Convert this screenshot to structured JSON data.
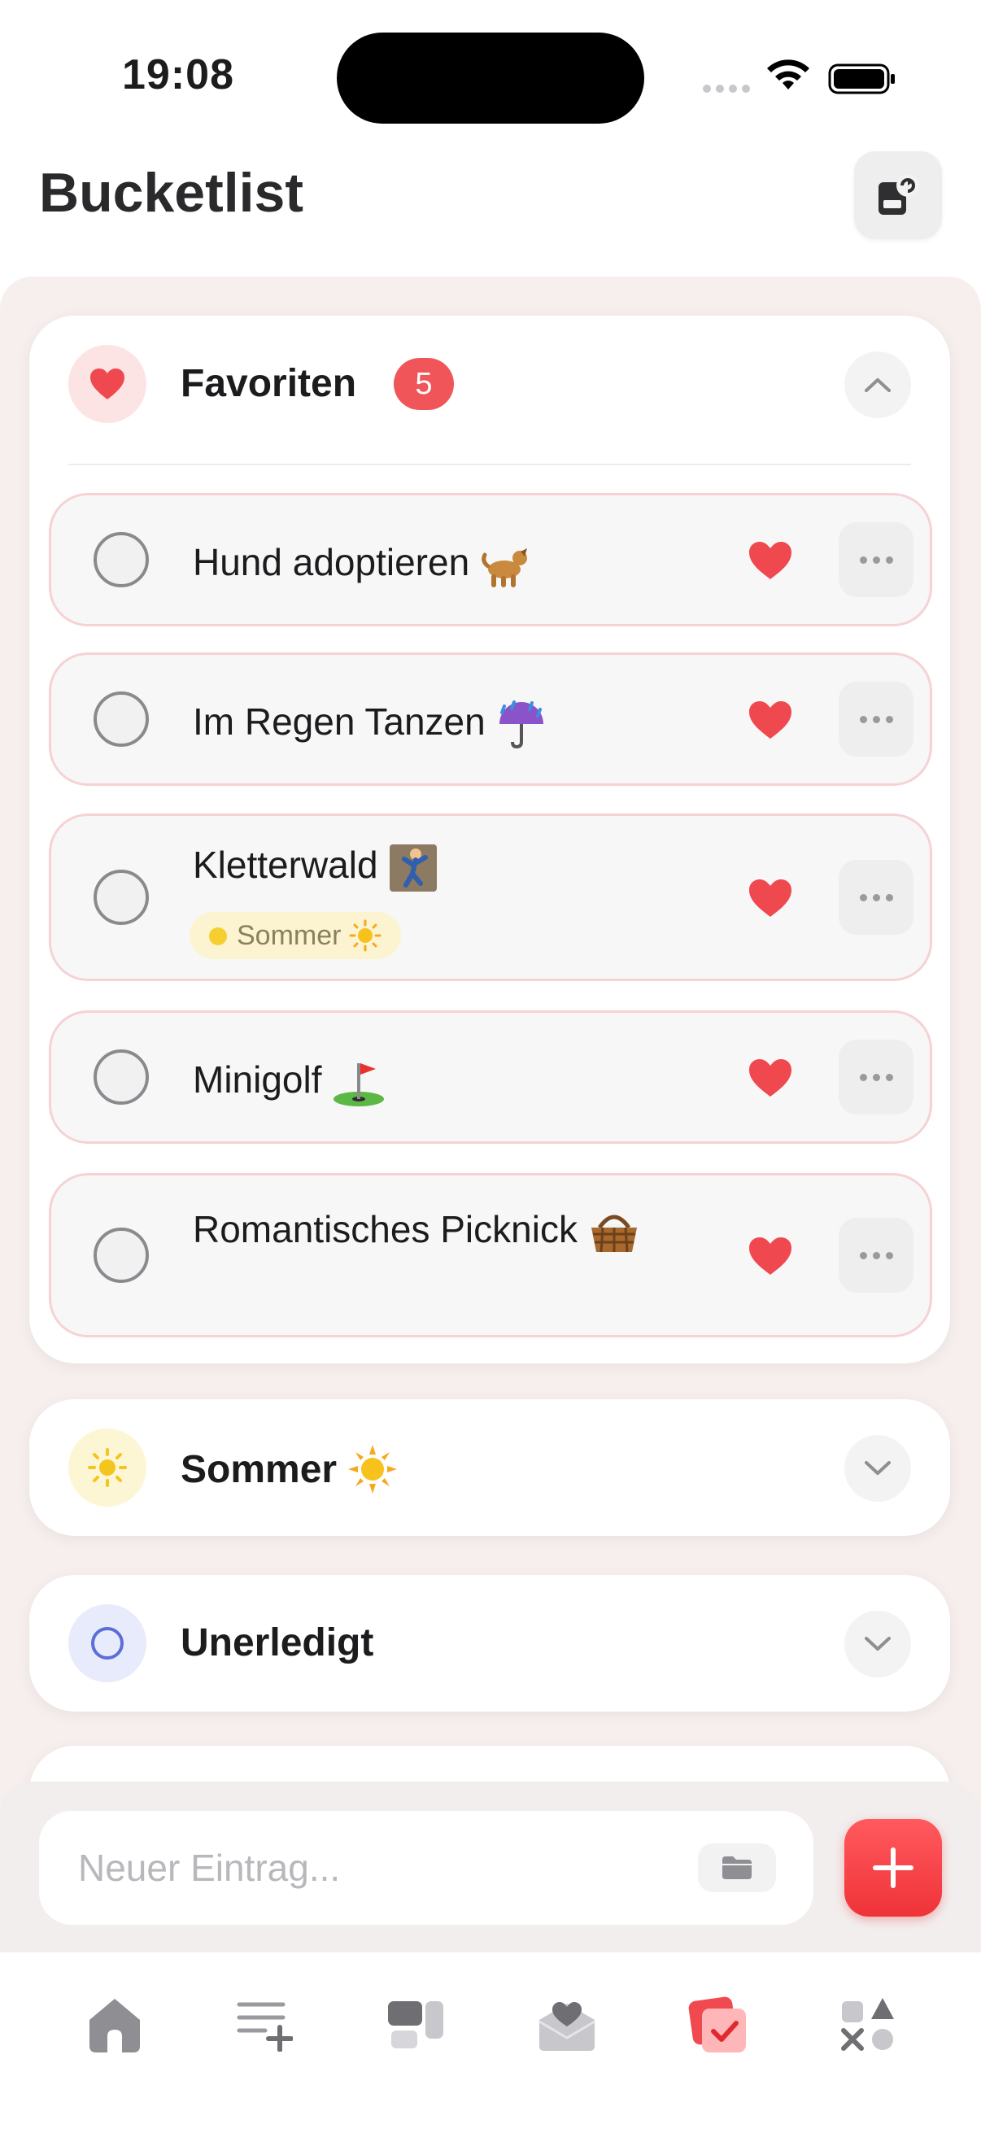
{
  "status_bar": {
    "time": "19:08"
  },
  "header": {
    "title": "Bucketlist",
    "action_icon": "sync-archive-icon"
  },
  "favorites": {
    "title": "Favoriten",
    "count": "5",
    "expanded": true,
    "items": [
      {
        "label": "Hund adoptieren",
        "emoji": "dog",
        "favorite": true
      },
      {
        "label": "Im Regen Tanzen",
        "emoji": "umbrella-rain",
        "favorite": true
      },
      {
        "label": "Kletterwald",
        "emoji": "climber",
        "favorite": true,
        "tag": "Sommer"
      },
      {
        "label": "Minigolf",
        "emoji": "golf-flag",
        "favorite": true
      },
      {
        "label": "Romantisches Picknick",
        "emoji": "basket",
        "favorite": true
      }
    ]
  },
  "categories": [
    {
      "title": "Sommer",
      "icon": "sun-icon",
      "expanded": false
    },
    {
      "title": "Unerledigt",
      "icon": "circle-icon",
      "expanded": false
    }
  ],
  "input": {
    "placeholder": "Neuer Eintrag..."
  },
  "tabs": [
    {
      "name": "home",
      "active": false
    },
    {
      "name": "add-list",
      "active": false
    },
    {
      "name": "widgets",
      "active": false
    },
    {
      "name": "love-mail",
      "active": false
    },
    {
      "name": "bucketlist",
      "active": true
    },
    {
      "name": "games",
      "active": false
    }
  ],
  "colors": {
    "accent_red": "#f0555a",
    "favorites_icon_bg": "#fde4e4",
    "summer_icon_bg": "#fdf6d4",
    "open_icon_bg": "#e8ebfb"
  }
}
